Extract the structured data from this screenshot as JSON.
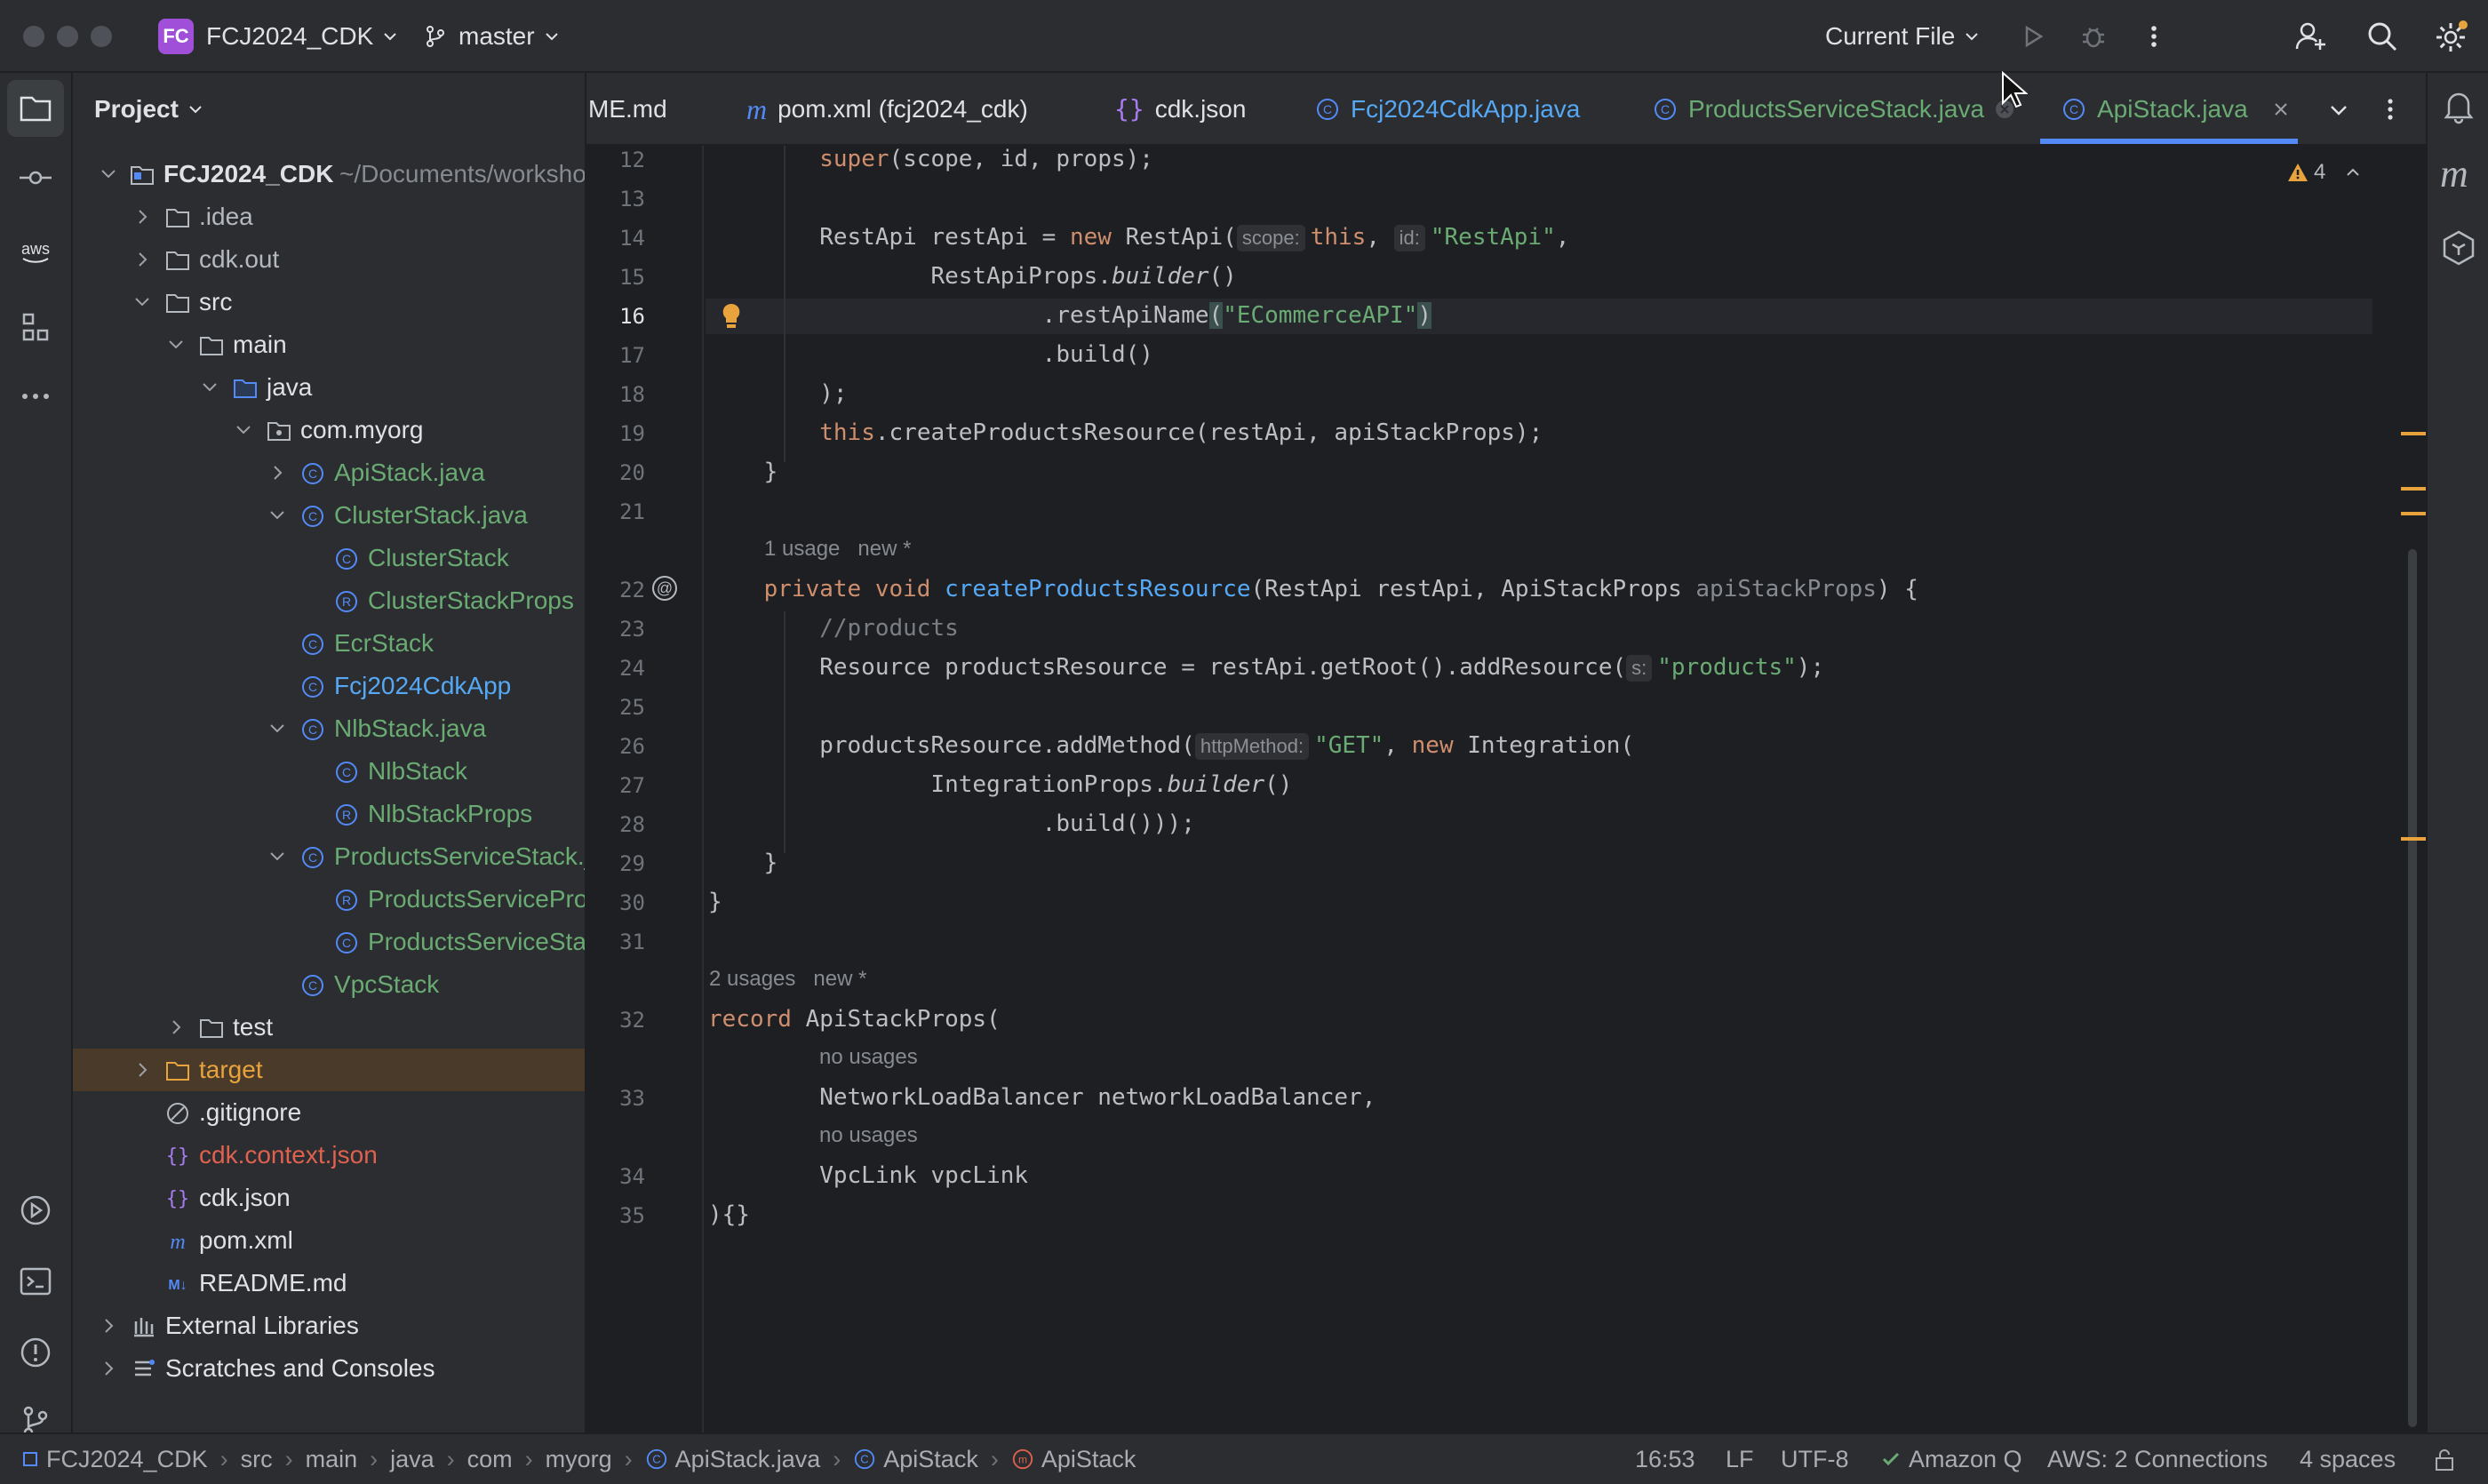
{
  "titlebar": {
    "project_badge": "FC",
    "project_name": "FCJ2024_CDK",
    "branch": "master",
    "run_config": "Current File"
  },
  "project_panel": {
    "title": "Project",
    "root_name": "FCJ2024_CDK",
    "root_path": "~/Documents/workshop",
    "items": [
      {
        "label": ".idea"
      },
      {
        "label": "cdk.out"
      },
      {
        "label": "src"
      },
      {
        "label": "main"
      },
      {
        "label": "java"
      },
      {
        "label": "com.myorg"
      },
      {
        "label": "ApiStack.java"
      },
      {
        "label": "ClusterStack.java"
      },
      {
        "label": "ClusterStack"
      },
      {
        "label": "ClusterStackProps"
      },
      {
        "label": "EcrStack"
      },
      {
        "label": "Fcj2024CdkApp"
      },
      {
        "label": "NlbStack.java"
      },
      {
        "label": "NlbStack"
      },
      {
        "label": "NlbStackProps"
      },
      {
        "label": "ProductsServiceStack.java"
      },
      {
        "label": "ProductsServiceProps"
      },
      {
        "label": "ProductsServiceStack"
      },
      {
        "label": "VpcStack"
      },
      {
        "label": "test"
      },
      {
        "label": "target"
      },
      {
        "label": ".gitignore"
      },
      {
        "label": "cdk.context.json"
      },
      {
        "label": "cdk.json"
      },
      {
        "label": "pom.xml"
      },
      {
        "label": "README.md"
      },
      {
        "label": "External Libraries"
      },
      {
        "label": "Scratches and Consoles"
      }
    ]
  },
  "tabs": [
    {
      "label": "ME.md"
    },
    {
      "label": "pom.xml (fcj2024_cdk)"
    },
    {
      "label": "cdk.json"
    },
    {
      "label": "Fcj2024CdkApp.java"
    },
    {
      "label": "ProductsServiceStack.java"
    },
    {
      "label": "ApiStack.java"
    }
  ],
  "editor": {
    "warnings": "4",
    "line_numbers": [
      "12",
      "13",
      "14",
      "15",
      "16",
      "17",
      "18",
      "19",
      "20",
      "21",
      "22",
      "23",
      "24",
      "25",
      "26",
      "27",
      "28",
      "29",
      "30",
      "31",
      "32",
      "33",
      "34",
      "35"
    ],
    "hint_usage1": "1 usage",
    "hint_new1": "new *",
    "hint_usage2": "2 usages",
    "hint_new2": "new *",
    "hint_no_usages": "no usages",
    "param_scope": "scope:",
    "param_id": "id:",
    "param_s": "s:",
    "param_http": "httpMethod:"
  },
  "statusbar": {
    "breadcrumbs": [
      "FCJ2024_CDK",
      "src",
      "main",
      "java",
      "com",
      "myorg",
      "ApiStack.java",
      "ApiStack",
      "ApiStack"
    ],
    "position": "16:53",
    "line_sep": "LF",
    "encoding": "UTF-8",
    "amazon_q": "Amazon Q",
    "aws": "AWS: 2 Connections",
    "indent": "4 spaces"
  }
}
